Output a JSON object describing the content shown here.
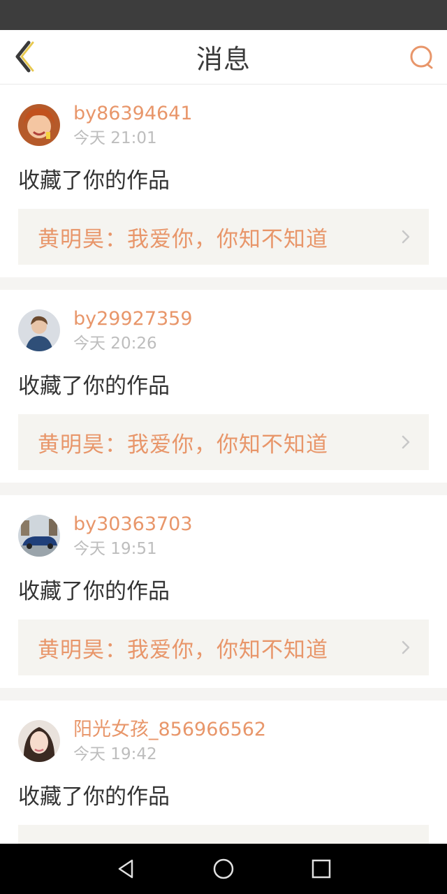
{
  "header": {
    "title": "消息",
    "back_icon": "chevron-left-icon",
    "search_icon": "search-icon",
    "accent_color": "#e8966a"
  },
  "messages": [
    {
      "username": "by86394641",
      "time": "今天 21:01",
      "action": "收藏了你的作品",
      "work": "黄明昊：我爱你，你知不知道"
    },
    {
      "username": "by29927359",
      "time": "今天 20:26",
      "action": "收藏了你的作品",
      "work": "黄明昊：我爱你，你知不知道"
    },
    {
      "username": "by30363703",
      "time": "今天 19:51",
      "action": "收藏了你的作品",
      "work": "黄明昊：我爱你，你知不知道"
    },
    {
      "username": "阳光女孩_856966562",
      "time": "今天 19:42",
      "action": "收藏了你的作品",
      "work": ""
    }
  ],
  "navbar": {
    "back_icon": "triangle-back-icon",
    "home_icon": "circle-home-icon",
    "recents_icon": "square-recents-icon"
  }
}
